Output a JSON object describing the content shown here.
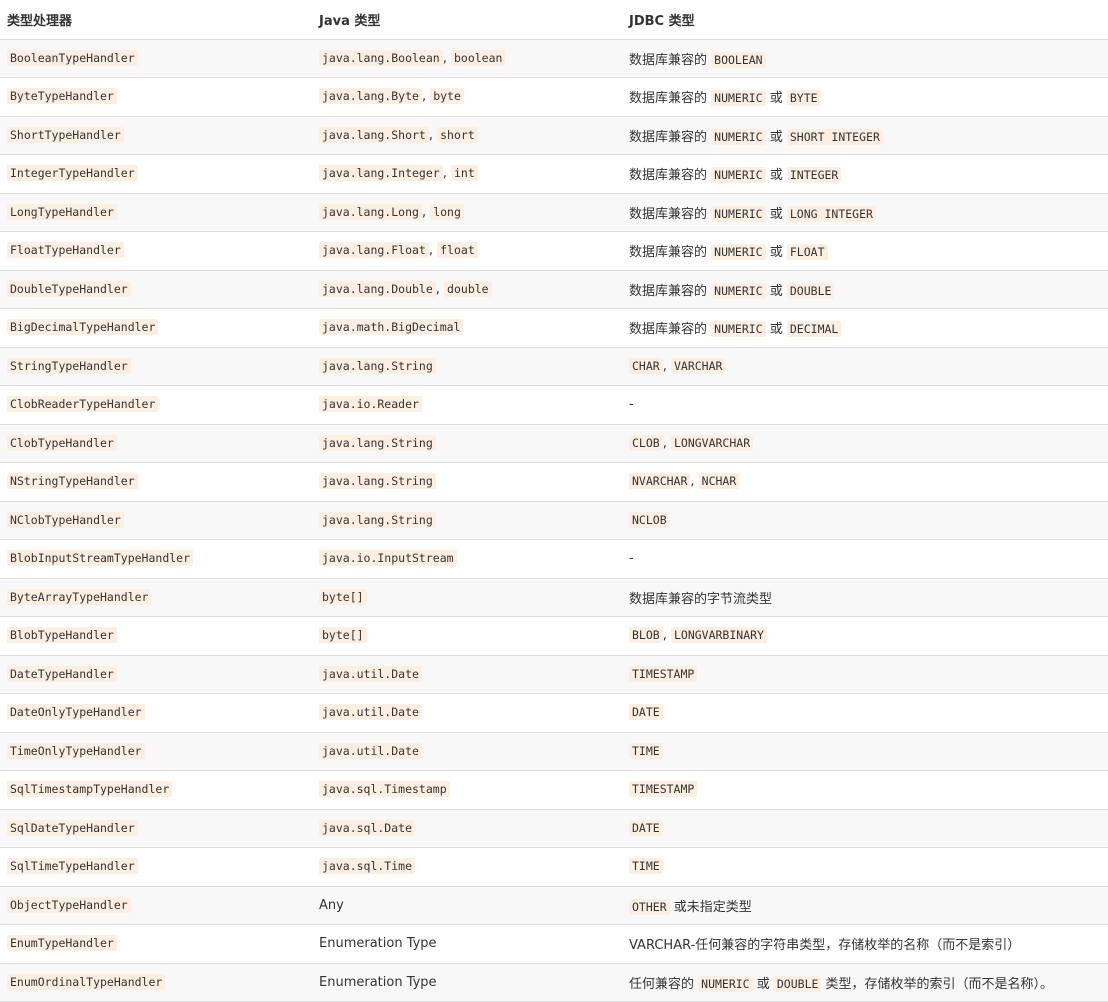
{
  "table": {
    "headers": [
      "类型处理器",
      "Java 类型",
      "JDBC 类型"
    ],
    "rows": [
      {
        "handler": "BooleanTypeHandler",
        "java": [
          {
            "t": "code",
            "v": "java.lang.Boolean"
          },
          {
            "t": "text",
            "v": ", "
          },
          {
            "t": "code",
            "v": "boolean"
          }
        ],
        "jdbc": [
          {
            "t": "text",
            "v": "数据库兼容的 "
          },
          {
            "t": "code",
            "v": "BOOLEAN"
          }
        ]
      },
      {
        "handler": "ByteTypeHandler",
        "java": [
          {
            "t": "code",
            "v": "java.lang.Byte"
          },
          {
            "t": "text",
            "v": ", "
          },
          {
            "t": "code",
            "v": "byte"
          }
        ],
        "jdbc": [
          {
            "t": "text",
            "v": "数据库兼容的 "
          },
          {
            "t": "code",
            "v": "NUMERIC"
          },
          {
            "t": "text",
            "v": " 或 "
          },
          {
            "t": "code",
            "v": "BYTE"
          }
        ]
      },
      {
        "handler": "ShortTypeHandler",
        "java": [
          {
            "t": "code",
            "v": "java.lang.Short"
          },
          {
            "t": "text",
            "v": ", "
          },
          {
            "t": "code",
            "v": "short"
          }
        ],
        "jdbc": [
          {
            "t": "text",
            "v": "数据库兼容的 "
          },
          {
            "t": "code",
            "v": "NUMERIC"
          },
          {
            "t": "text",
            "v": " 或 "
          },
          {
            "t": "code",
            "v": "SHORT INTEGER"
          }
        ]
      },
      {
        "handler": "IntegerTypeHandler",
        "java": [
          {
            "t": "code",
            "v": "java.lang.Integer"
          },
          {
            "t": "text",
            "v": ", "
          },
          {
            "t": "code",
            "v": "int"
          }
        ],
        "jdbc": [
          {
            "t": "text",
            "v": "数据库兼容的 "
          },
          {
            "t": "code",
            "v": "NUMERIC"
          },
          {
            "t": "text",
            "v": " 或 "
          },
          {
            "t": "code",
            "v": "INTEGER"
          }
        ]
      },
      {
        "handler": "LongTypeHandler",
        "java": [
          {
            "t": "code",
            "v": "java.lang.Long"
          },
          {
            "t": "text",
            "v": ", "
          },
          {
            "t": "code",
            "v": "long"
          }
        ],
        "jdbc": [
          {
            "t": "text",
            "v": "数据库兼容的 "
          },
          {
            "t": "code",
            "v": "NUMERIC"
          },
          {
            "t": "text",
            "v": " 或 "
          },
          {
            "t": "code",
            "v": "LONG INTEGER"
          }
        ]
      },
      {
        "handler": "FloatTypeHandler",
        "java": [
          {
            "t": "code",
            "v": "java.lang.Float"
          },
          {
            "t": "text",
            "v": ", "
          },
          {
            "t": "code",
            "v": "float"
          }
        ],
        "jdbc": [
          {
            "t": "text",
            "v": "数据库兼容的 "
          },
          {
            "t": "code",
            "v": "NUMERIC"
          },
          {
            "t": "text",
            "v": " 或 "
          },
          {
            "t": "code",
            "v": "FLOAT"
          }
        ]
      },
      {
        "handler": "DoubleTypeHandler",
        "java": [
          {
            "t": "code",
            "v": "java.lang.Double"
          },
          {
            "t": "text",
            "v": ", "
          },
          {
            "t": "code",
            "v": "double"
          }
        ],
        "jdbc": [
          {
            "t": "text",
            "v": "数据库兼容的 "
          },
          {
            "t": "code",
            "v": "NUMERIC"
          },
          {
            "t": "text",
            "v": " 或 "
          },
          {
            "t": "code",
            "v": "DOUBLE"
          }
        ]
      },
      {
        "handler": "BigDecimalTypeHandler",
        "java": [
          {
            "t": "code",
            "v": "java.math.BigDecimal"
          }
        ],
        "jdbc": [
          {
            "t": "text",
            "v": "数据库兼容的 "
          },
          {
            "t": "code",
            "v": "NUMERIC"
          },
          {
            "t": "text",
            "v": " 或 "
          },
          {
            "t": "code",
            "v": "DECIMAL"
          }
        ]
      },
      {
        "handler": "StringTypeHandler",
        "java": [
          {
            "t": "code",
            "v": "java.lang.String"
          }
        ],
        "jdbc": [
          {
            "t": "code",
            "v": "CHAR"
          },
          {
            "t": "text",
            "v": ", "
          },
          {
            "t": "code",
            "v": "VARCHAR"
          }
        ]
      },
      {
        "handler": "ClobReaderTypeHandler",
        "java": [
          {
            "t": "code",
            "v": "java.io.Reader"
          }
        ],
        "jdbc": [
          {
            "t": "text",
            "v": "-"
          }
        ]
      },
      {
        "handler": "ClobTypeHandler",
        "java": [
          {
            "t": "code",
            "v": "java.lang.String"
          }
        ],
        "jdbc": [
          {
            "t": "code",
            "v": "CLOB"
          },
          {
            "t": "text",
            "v": ", "
          },
          {
            "t": "code",
            "v": "LONGVARCHAR"
          }
        ]
      },
      {
        "handler": "NStringTypeHandler",
        "java": [
          {
            "t": "code",
            "v": "java.lang.String"
          }
        ],
        "jdbc": [
          {
            "t": "code",
            "v": "NVARCHAR"
          },
          {
            "t": "text",
            "v": ", "
          },
          {
            "t": "code",
            "v": "NCHAR"
          }
        ]
      },
      {
        "handler": "NClobTypeHandler",
        "java": [
          {
            "t": "code",
            "v": "java.lang.String"
          }
        ],
        "jdbc": [
          {
            "t": "code",
            "v": "NCLOB"
          }
        ]
      },
      {
        "handler": "BlobInputStreamTypeHandler",
        "java": [
          {
            "t": "code",
            "v": "java.io.InputStream"
          }
        ],
        "jdbc": [
          {
            "t": "text",
            "v": "-"
          }
        ]
      },
      {
        "handler": "ByteArrayTypeHandler",
        "java": [
          {
            "t": "code",
            "v": "byte[]"
          }
        ],
        "jdbc": [
          {
            "t": "text",
            "v": "数据库兼容的字节流类型"
          }
        ]
      },
      {
        "handler": "BlobTypeHandler",
        "java": [
          {
            "t": "code",
            "v": "byte[]"
          }
        ],
        "jdbc": [
          {
            "t": "code",
            "v": "BLOB"
          },
          {
            "t": "text",
            "v": ", "
          },
          {
            "t": "code",
            "v": "LONGVARBINARY"
          }
        ]
      },
      {
        "handler": "DateTypeHandler",
        "java": [
          {
            "t": "code",
            "v": "java.util.Date"
          }
        ],
        "jdbc": [
          {
            "t": "code",
            "v": "TIMESTAMP"
          }
        ]
      },
      {
        "handler": "DateOnlyTypeHandler",
        "java": [
          {
            "t": "code",
            "v": "java.util.Date"
          }
        ],
        "jdbc": [
          {
            "t": "code",
            "v": "DATE"
          }
        ]
      },
      {
        "handler": "TimeOnlyTypeHandler",
        "java": [
          {
            "t": "code",
            "v": "java.util.Date"
          }
        ],
        "jdbc": [
          {
            "t": "code",
            "v": "TIME"
          }
        ]
      },
      {
        "handler": "SqlTimestampTypeHandler",
        "java": [
          {
            "t": "code",
            "v": "java.sql.Timestamp"
          }
        ],
        "jdbc": [
          {
            "t": "code",
            "v": "TIMESTAMP"
          }
        ]
      },
      {
        "handler": "SqlDateTypeHandler",
        "java": [
          {
            "t": "code",
            "v": "java.sql.Date"
          }
        ],
        "jdbc": [
          {
            "t": "code",
            "v": "DATE"
          }
        ]
      },
      {
        "handler": "SqlTimeTypeHandler",
        "java": [
          {
            "t": "code",
            "v": "java.sql.Time"
          }
        ],
        "jdbc": [
          {
            "t": "code",
            "v": "TIME"
          }
        ]
      },
      {
        "handler": "ObjectTypeHandler",
        "java": [
          {
            "t": "text",
            "v": "Any"
          }
        ],
        "jdbc": [
          {
            "t": "code",
            "v": "OTHER"
          },
          {
            "t": "text",
            "v": " 或未指定类型"
          }
        ]
      },
      {
        "handler": "EnumTypeHandler",
        "java": [
          {
            "t": "text",
            "v": "Enumeration Type"
          }
        ],
        "jdbc": [
          {
            "t": "text",
            "v": "VARCHAR-任何兼容的字符串类型，存储枚举的名称（而不是索引）"
          }
        ]
      },
      {
        "handler": "EnumOrdinalTypeHandler",
        "java": [
          {
            "t": "text",
            "v": "Enumeration Type"
          }
        ],
        "jdbc": [
          {
            "t": "text",
            "v": "任何兼容的 "
          },
          {
            "t": "code",
            "v": "NUMERIC"
          },
          {
            "t": "text",
            "v": " 或 "
          },
          {
            "t": "code",
            "v": "DOUBLE"
          },
          {
            "t": "text",
            "v": " 类型，存储枚举的索引（而不是名称）。"
          }
        ]
      }
    ]
  },
  "colors": {
    "code_bg": "#fcefe2",
    "row_stripe": "#f8f8f8",
    "border": "#dddddd",
    "text": "#333333"
  }
}
